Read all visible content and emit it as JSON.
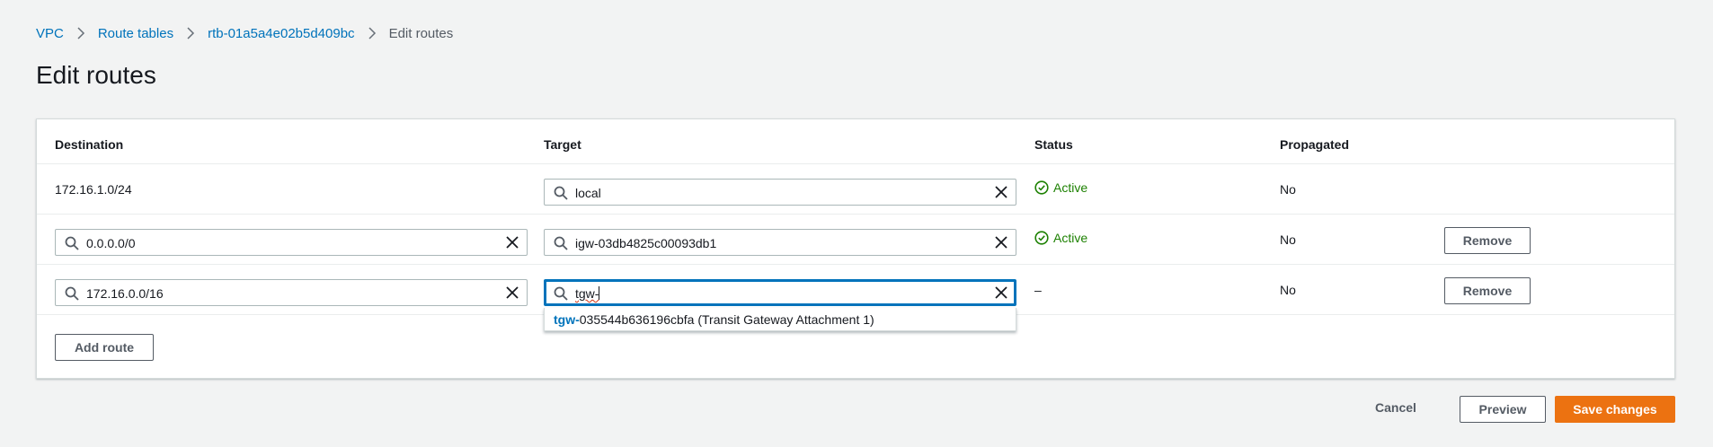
{
  "breadcrumb": {
    "items": [
      "VPC",
      "Route tables",
      "rtb-01a5a4e02b5d409bc"
    ],
    "current": "Edit routes"
  },
  "page_title": "Edit routes",
  "table": {
    "headers": {
      "destination": "Destination",
      "target": "Target",
      "status": "Status",
      "propagated": "Propagated"
    },
    "rows": [
      {
        "destination": "172.16.1.0/24",
        "target": "local",
        "status": "Active",
        "propagated": "No"
      },
      {
        "destination": "0.0.0.0/0",
        "target": "igw-03db4825c00093db1",
        "status": "Active",
        "propagated": "No",
        "remove_label": "Remove"
      },
      {
        "destination": "172.16.0.0/16",
        "target": "tgw-",
        "status": "–",
        "propagated": "No",
        "remove_label": "Remove"
      }
    ]
  },
  "autocomplete": {
    "match": "tgw-",
    "rest": "035544b636196cbfa (Transit Gateway Attachment 1)"
  },
  "add_route_label": "Add route",
  "footer": {
    "cancel_label": "Cancel",
    "preview_label": "Preview",
    "save_label": "Save changes"
  },
  "colors": {
    "link": "#0073bb",
    "success": "#1d8102",
    "primary": "#ec7211"
  },
  "icons": {
    "search": "search-icon",
    "clear": "close-icon",
    "status": "check-circle-icon",
    "separator": "chevron-right-icon"
  }
}
